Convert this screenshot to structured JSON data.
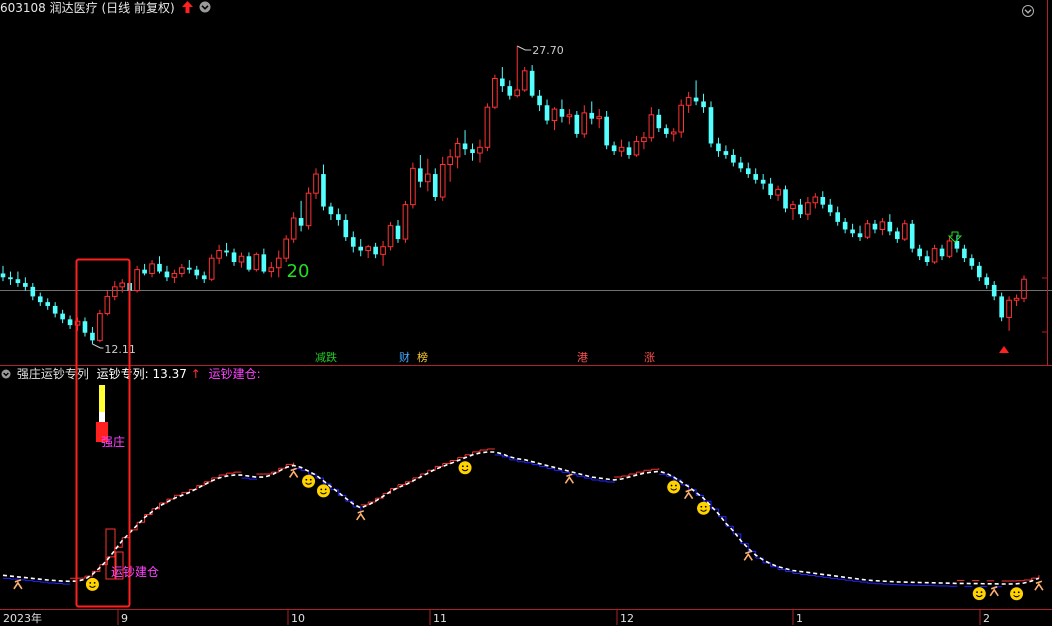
{
  "header": {
    "code": "603108",
    "name": "润达医疗",
    "mode": "(日线 前复权)",
    "up_arrow_icon": "red-up-arrow-icon",
    "dropdown_icon": "chevron-down-icon",
    "corner_icon": "chevron-down-icon"
  },
  "price_labels": {
    "high": "27.70",
    "low": "12.11"
  },
  "count_label": "20",
  "event_tags": [
    {
      "text": "减跌",
      "color": "#22cc22"
    },
    {
      "text": "财",
      "color": "#44aaff"
    },
    {
      "text": "榜",
      "color": "#ffcc33"
    },
    {
      "text": "港",
      "color": "#ff5050"
    },
    {
      "text": "涨",
      "color": "#ff5050"
    }
  ],
  "indicator": {
    "title": "强庄运钞专列",
    "param_label": "运钞专列:",
    "param_value": "13.37",
    "arrow": "↑",
    "series2_label": "运钞建仓:",
    "label_strong": "强庄",
    "label_build": "运钞建仓"
  },
  "time_axis": [
    "2023年",
    "9",
    "10",
    "11",
    "12",
    "1",
    "2"
  ],
  "colors": {
    "up": "#ff3232",
    "down": "#54ffff",
    "axis": "#b0202a",
    "mid_line": "#808080",
    "indicator_line": "#ffffff",
    "step_up": "#ff3232",
    "step_down": "#2222ff",
    "highlight_box": "#ff2020",
    "smiley": "#ffd200",
    "runner": "#ffb070"
  },
  "chart_data": {
    "type": "candlestick",
    "symbol": "603108",
    "candles": [
      [
        15.8,
        16.2,
        15.4,
        15.6
      ],
      [
        15.6,
        15.9,
        15.2,
        15.5
      ],
      [
        15.5,
        15.9,
        15.1,
        15.3
      ],
      [
        15.3,
        15.6,
        14.9,
        15.1
      ],
      [
        15.1,
        15.3,
        14.4,
        14.6
      ],
      [
        14.6,
        14.8,
        14.1,
        14.3
      ],
      [
        14.3,
        14.5,
        13.9,
        14.1
      ],
      [
        14.1,
        14.3,
        13.5,
        13.7
      ],
      [
        13.7,
        13.9,
        13.2,
        13.4
      ],
      [
        13.4,
        13.6,
        12.9,
        13.1
      ],
      [
        13.1,
        13.5,
        12.8,
        13.3
      ],
      [
        13.3,
        13.5,
        12.5,
        12.7
      ],
      [
        12.7,
        13.0,
        12.11,
        12.3
      ],
      [
        12.3,
        13.9,
        12.2,
        13.7
      ],
      [
        13.7,
        14.9,
        13.6,
        14.6
      ],
      [
        14.6,
        15.4,
        14.4,
        15.1
      ],
      [
        15.1,
        15.5,
        14.8,
        15.3
      ],
      [
        15.3,
        15.6,
        14.7,
        14.9
      ],
      [
        14.9,
        16.2,
        14.8,
        16.0
      ],
      [
        16.0,
        16.3,
        15.7,
        15.8
      ],
      [
        15.8,
        16.5,
        15.6,
        16.3
      ],
      [
        16.3,
        16.7,
        15.8,
        15.9
      ],
      [
        15.9,
        16.2,
        15.4,
        15.6
      ],
      [
        15.6,
        16.0,
        15.3,
        15.8
      ],
      [
        15.8,
        16.3,
        15.6,
        16.1
      ],
      [
        16.1,
        16.5,
        15.8,
        16.0
      ],
      [
        16.0,
        16.2,
        15.5,
        15.7
      ],
      [
        15.7,
        15.9,
        15.3,
        15.5
      ],
      [
        15.5,
        16.8,
        15.4,
        16.6
      ],
      [
        16.6,
        17.3,
        16.3,
        17.0
      ],
      [
        17.0,
        17.4,
        16.7,
        16.9
      ],
      [
        16.9,
        17.1,
        16.2,
        16.4
      ],
      [
        16.4,
        16.9,
        16.1,
        16.7
      ],
      [
        16.7,
        16.9,
        15.9,
        16.0
      ],
      [
        16.0,
        16.9,
        15.9,
        16.8
      ],
      [
        16.8,
        17.1,
        15.8,
        15.9
      ],
      [
        15.9,
        16.4,
        15.6,
        16.1
      ],
      [
        16.1,
        17.0,
        15.6,
        16.6
      ],
      [
        16.6,
        17.8,
        16.4,
        17.6
      ],
      [
        17.6,
        19.0,
        17.4,
        18.7
      ],
      [
        18.7,
        19.6,
        18.0,
        18.3
      ],
      [
        18.3,
        20.3,
        18.1,
        20.0
      ],
      [
        20.0,
        21.3,
        19.7,
        21.0
      ],
      [
        21.0,
        21.5,
        19.1,
        19.3
      ],
      [
        19.3,
        19.5,
        18.6,
        18.9
      ],
      [
        18.9,
        19.2,
        18.3,
        18.6
      ],
      [
        18.6,
        18.9,
        17.5,
        17.7
      ],
      [
        17.7,
        18.0,
        16.9,
        17.2
      ],
      [
        17.2,
        17.6,
        16.7,
        17.0
      ],
      [
        17.0,
        17.3,
        16.6,
        17.2
      ],
      [
        17.2,
        17.4,
        16.6,
        16.8
      ],
      [
        16.8,
        17.5,
        16.2,
        17.2
      ],
      [
        17.2,
        18.5,
        17.0,
        18.3
      ],
      [
        18.3,
        18.6,
        17.4,
        17.6
      ],
      [
        17.6,
        19.6,
        17.4,
        19.4
      ],
      [
        19.4,
        21.6,
        19.2,
        21.3
      ],
      [
        21.3,
        22.0,
        20.3,
        20.6
      ],
      [
        20.6,
        21.8,
        20.1,
        21.0
      ],
      [
        21.0,
        21.3,
        19.6,
        19.8
      ],
      [
        19.8,
        21.9,
        19.6,
        21.5
      ],
      [
        21.5,
        22.3,
        20.6,
        21.9
      ],
      [
        21.9,
        22.9,
        21.3,
        22.6
      ],
      [
        22.6,
        23.3,
        22.0,
        22.3
      ],
      [
        22.3,
        22.6,
        21.7,
        22.1
      ],
      [
        22.1,
        22.8,
        21.6,
        22.4
      ],
      [
        22.4,
        24.7,
        22.2,
        24.5
      ],
      [
        24.5,
        26.2,
        24.4,
        26.0
      ],
      [
        26.0,
        26.6,
        25.3,
        25.6
      ],
      [
        25.6,
        25.9,
        24.9,
        25.1
      ],
      [
        25.1,
        27.7,
        25.0,
        25.4
      ],
      [
        25.4,
        26.6,
        25.3,
        26.4
      ],
      [
        26.4,
        26.7,
        25.0,
        25.1
      ],
      [
        25.1,
        25.4,
        24.3,
        24.6
      ],
      [
        24.6,
        24.9,
        23.6,
        23.8
      ],
      [
        23.8,
        24.5,
        23.3,
        24.4
      ],
      [
        24.4,
        24.9,
        23.7,
        24.0
      ],
      [
        24.0,
        24.4,
        23.6,
        24.1
      ],
      [
        24.1,
        24.3,
        22.9,
        23.1
      ],
      [
        23.1,
        24.6,
        22.9,
        24.2
      ],
      [
        24.2,
        24.8,
        23.6,
        23.9
      ],
      [
        23.9,
        24.4,
        23.4,
        24.0
      ],
      [
        24.0,
        24.3,
        22.3,
        22.5
      ],
      [
        22.5,
        22.7,
        22.0,
        22.2
      ],
      [
        22.2,
        22.8,
        21.9,
        22.4
      ],
      [
        22.4,
        22.7,
        21.8,
        22.0
      ],
      [
        22.0,
        23.0,
        21.9,
        22.7
      ],
      [
        22.7,
        23.2,
        22.3,
        22.9
      ],
      [
        22.9,
        24.5,
        22.7,
        24.1
      ],
      [
        24.1,
        24.4,
        23.2,
        23.4
      ],
      [
        23.4,
        23.6,
        22.9,
        23.1
      ],
      [
        23.1,
        23.4,
        22.7,
        23.2
      ],
      [
        23.2,
        24.9,
        22.9,
        24.6
      ],
      [
        24.6,
        25.3,
        24.2,
        25.0
      ],
      [
        25.0,
        25.9,
        24.6,
        24.8
      ],
      [
        24.8,
        25.2,
        24.2,
        24.5
      ],
      [
        24.5,
        24.8,
        22.4,
        22.6
      ],
      [
        22.6,
        22.9,
        21.9,
        22.2
      ],
      [
        22.2,
        22.5,
        21.8,
        22.0
      ],
      [
        22.0,
        22.3,
        21.4,
        21.6
      ],
      [
        21.6,
        21.9,
        21.1,
        21.3
      ],
      [
        21.3,
        21.6,
        20.8,
        21.0
      ],
      [
        21.0,
        21.3,
        20.5,
        20.7
      ],
      [
        20.7,
        21.0,
        20.2,
        20.5
      ],
      [
        20.5,
        20.8,
        19.7,
        19.9
      ],
      [
        19.9,
        20.4,
        19.6,
        20.2
      ],
      [
        20.2,
        20.4,
        19.0,
        19.2
      ],
      [
        19.2,
        19.6,
        18.6,
        19.4
      ],
      [
        19.4,
        19.7,
        18.7,
        18.9
      ],
      [
        18.9,
        19.8,
        18.6,
        19.5
      ],
      [
        19.5,
        20.0,
        19.2,
        19.8
      ],
      [
        19.8,
        20.1,
        19.2,
        19.4
      ],
      [
        19.4,
        19.7,
        18.8,
        19.0
      ],
      [
        19.0,
        19.3,
        18.3,
        18.5
      ],
      [
        18.5,
        18.7,
        17.9,
        18.1
      ],
      [
        18.1,
        18.4,
        17.7,
        17.9
      ],
      [
        17.9,
        18.3,
        17.5,
        17.7
      ],
      [
        17.7,
        18.6,
        17.6,
        18.4
      ],
      [
        18.4,
        18.6,
        17.9,
        18.1
      ],
      [
        18.1,
        18.7,
        17.8,
        18.5
      ],
      [
        18.5,
        18.9,
        17.8,
        18.0
      ],
      [
        18.0,
        18.2,
        17.4,
        17.6
      ],
      [
        17.6,
        18.6,
        17.5,
        18.4
      ],
      [
        18.4,
        18.6,
        16.9,
        17.1
      ],
      [
        17.1,
        17.3,
        16.5,
        16.7
      ],
      [
        16.7,
        17.0,
        16.2,
        16.4
      ],
      [
        16.4,
        17.3,
        16.3,
        17.1
      ],
      [
        17.1,
        17.3,
        16.5,
        16.7
      ],
      [
        16.7,
        17.7,
        16.6,
        17.5
      ],
      [
        17.5,
        17.8,
        16.9,
        17.1
      ],
      [
        17.1,
        17.3,
        16.4,
        16.6
      ],
      [
        16.6,
        16.8,
        16.0,
        16.2
      ],
      [
        16.2,
        16.4,
        15.4,
        15.6
      ],
      [
        15.6,
        15.8,
        15.0,
        15.2
      ],
      [
        15.2,
        15.4,
        14.4,
        14.6
      ],
      [
        14.6,
        14.8,
        13.3,
        13.5
      ],
      [
        13.5,
        14.6,
        12.8,
        14.4
      ],
      [
        14.4,
        14.7,
        14.1,
        14.5
      ],
      [
        14.5,
        15.7,
        14.3,
        15.5
      ]
    ],
    "price_markers": {
      "high": 27.7,
      "low": 12.11
    },
    "indicator_series": {
      "name": "运钞专列",
      "values": [
        10.0,
        9.6,
        9.2,
        8.8,
        8.4,
        8.0,
        7.6,
        7.3,
        7.0,
        6.9,
        7.0,
        8.0,
        10.5,
        14.0,
        18.0,
        23.0,
        28.0,
        32.0,
        36.0,
        40.0,
        43.0,
        46.0,
        48.0,
        50.0,
        51.5,
        53.0,
        55.0,
        57.0,
        59.0,
        60.5,
        61.5,
        62.0,
        62.0,
        61.5,
        61.0,
        61.0,
        62.0,
        64.0,
        66.0,
        67.0,
        66.0,
        64.0,
        62.0,
        59.0,
        56.0,
        53.0,
        50.0,
        47.0,
        45.0,
        46.5,
        48.5,
        51.0,
        53.5,
        55.5,
        57.0,
        59.0,
        61.0,
        63.0,
        65.0,
        66.5,
        68.0,
        69.5,
        71.0,
        72.5,
        73.5,
        74.0,
        74.0,
        73.0,
        71.5,
        70.5,
        70.0,
        69.0,
        68.0,
        67.0,
        66.0,
        65.0,
        64.0,
        63.0,
        62.0,
        61.0,
        60.5,
        60.0,
        59.5,
        60.0,
        61.0,
        62.0,
        63.0,
        63.5,
        64.0,
        63.0,
        61.0,
        58.5,
        56.0,
        53.0,
        50.0,
        46.0,
        42.0,
        37.0,
        33.0,
        28.0,
        24.0,
        20.5,
        18.0,
        16.0,
        14.5,
        13.5,
        12.5,
        12.0,
        11.5,
        11.0,
        10.5,
        10.0,
        9.5,
        9.0,
        8.5,
        8.0,
        7.5,
        7.2,
        7.0,
        6.8,
        6.6,
        6.5,
        6.4,
        6.3,
        6.2,
        6.1,
        6.0,
        5.9,
        5.8,
        5.8,
        5.7,
        5.7,
        5.6,
        5.6,
        5.5,
        5.5,
        5.6,
        6.0,
        7.0,
        8.5
      ]
    },
    "indicator_value": 13.37,
    "x_axis_labels": [
      "2023年",
      "9",
      "10",
      "11",
      "12",
      "1",
      "2"
    ]
  }
}
